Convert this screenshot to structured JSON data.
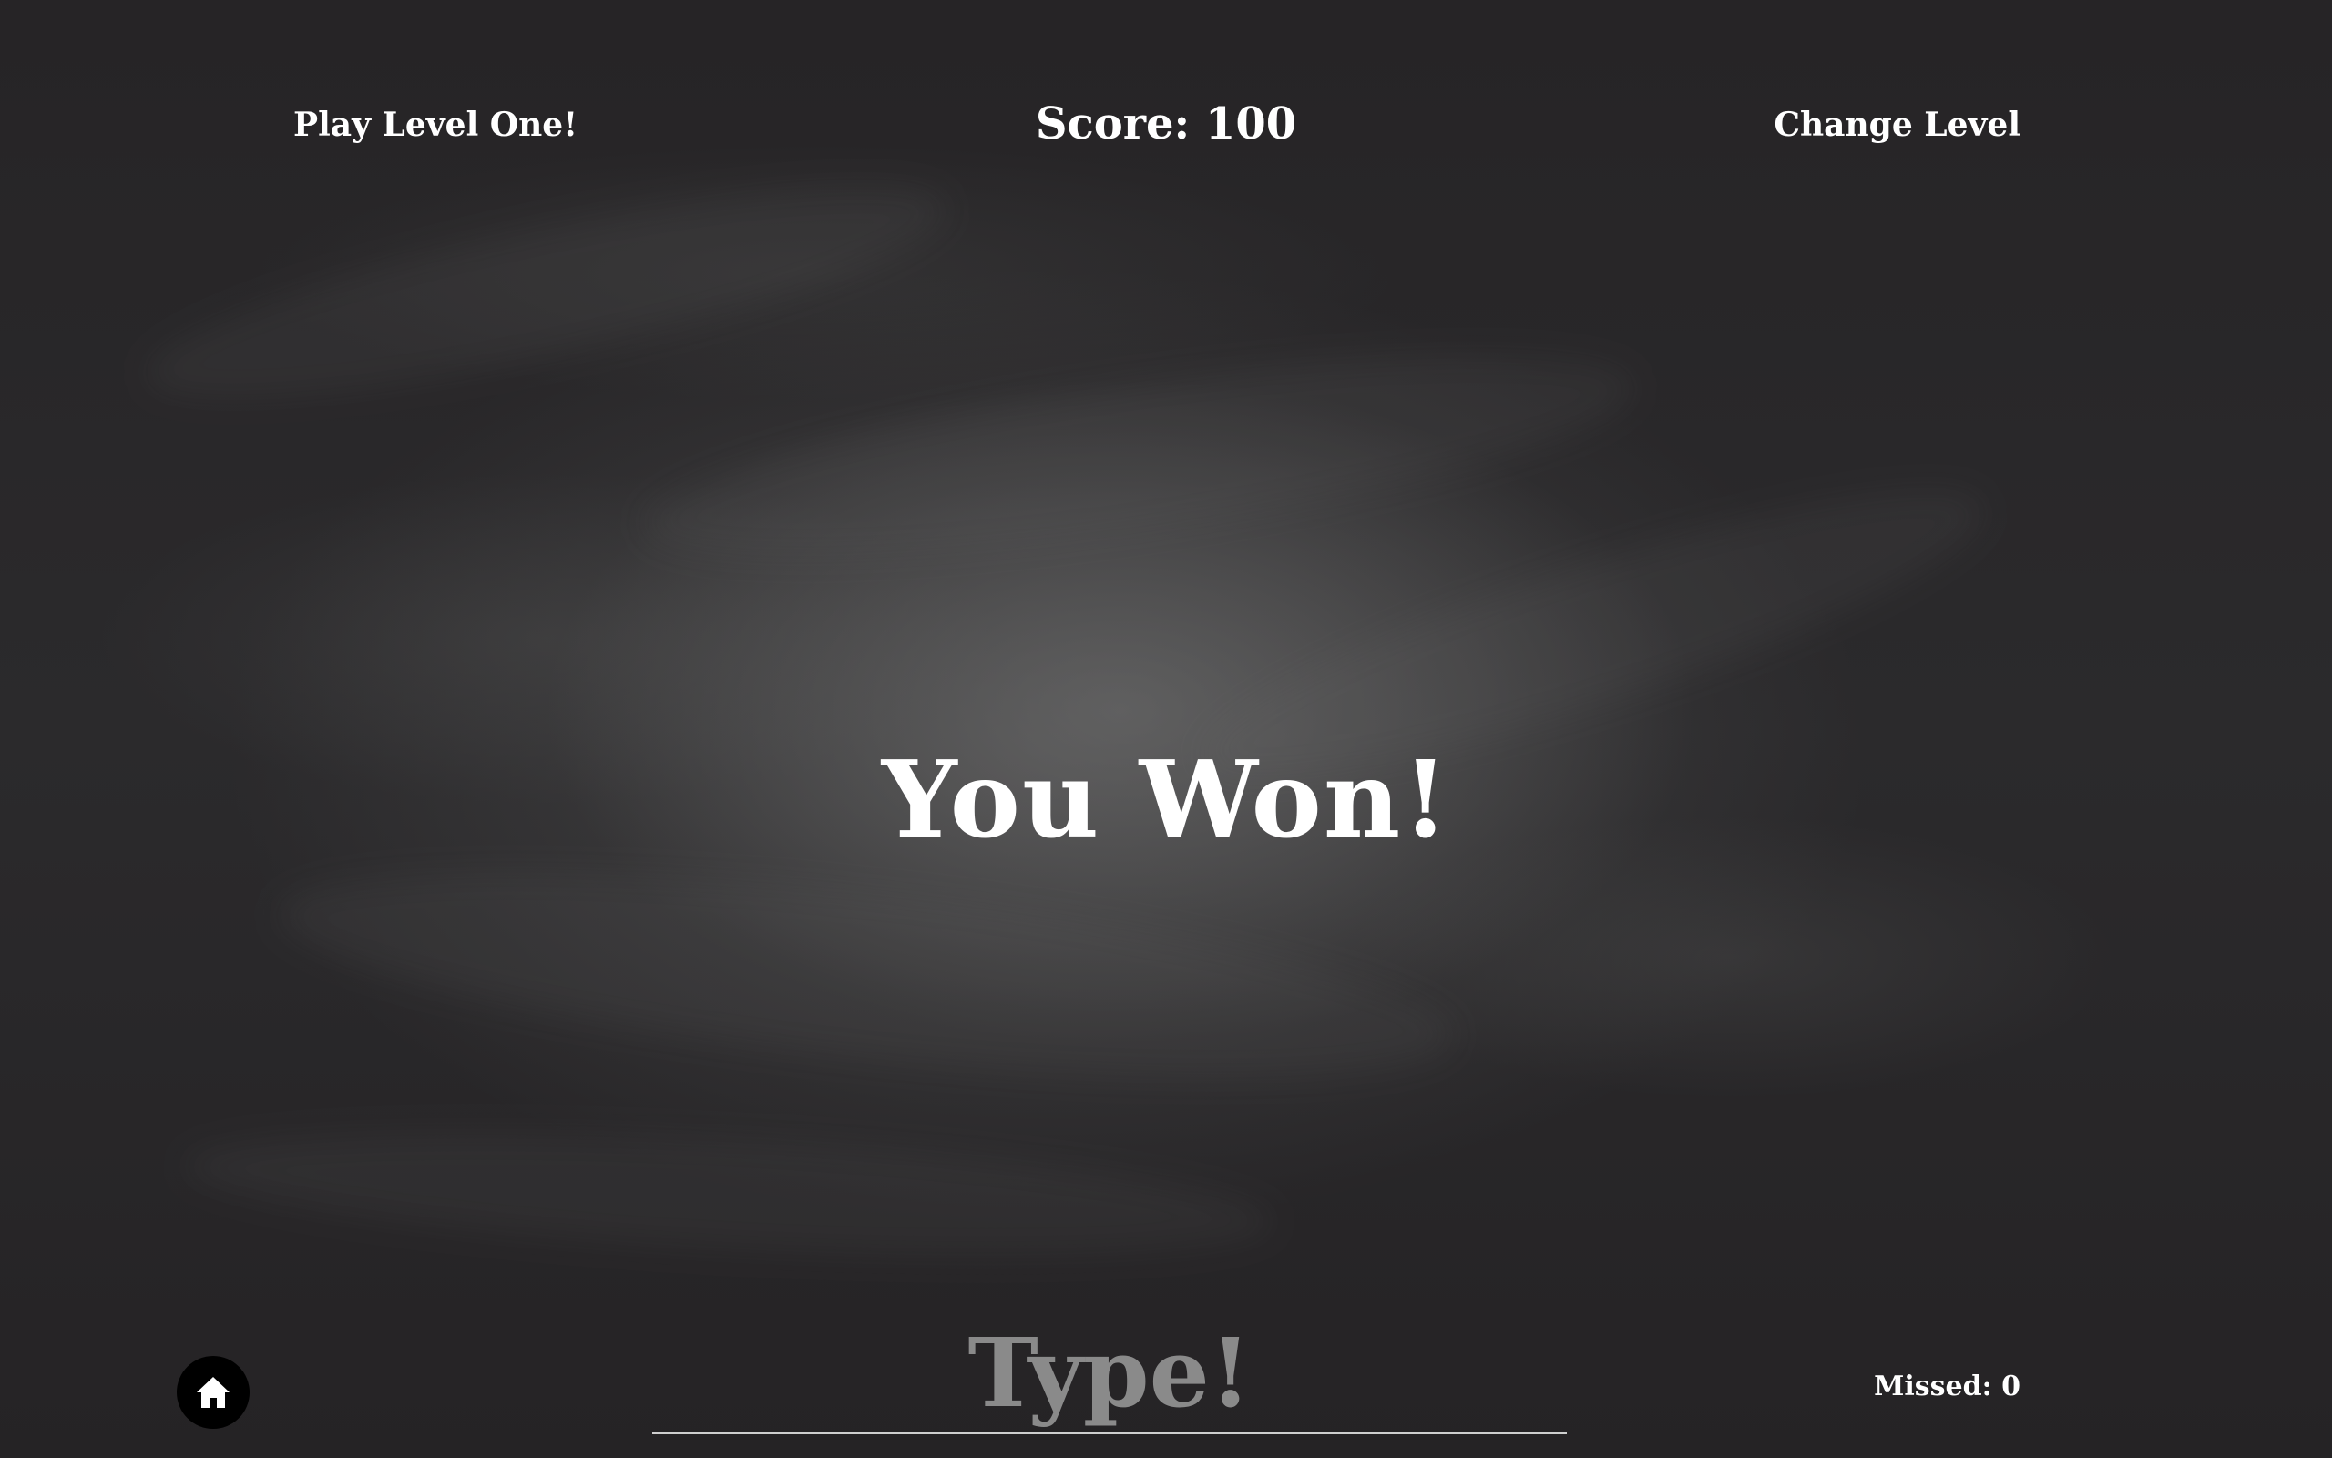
{
  "header": {
    "play_level_label": "Play Level One!",
    "score_label": "Score:",
    "score_value": "100",
    "change_level_label": "Change Level"
  },
  "main": {
    "message": "You Won!"
  },
  "footer": {
    "home_icon": "home-icon",
    "type_placeholder": "Type!",
    "type_value": "",
    "missed_label": "Missed:",
    "missed_value": "0"
  },
  "colors": {
    "text": "#ffffff",
    "placeholder": "#8a8a8a",
    "board": "#2b2a2c",
    "home_button": "#000000"
  }
}
